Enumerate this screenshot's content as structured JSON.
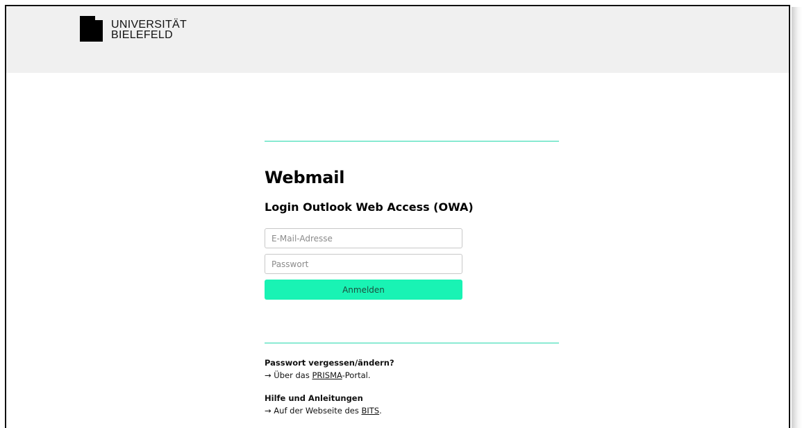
{
  "brand": {
    "line1": "UNIVERSITÄT",
    "line2": "BIELEFELD"
  },
  "main": {
    "title": "Webmail",
    "subtitle": "Login Outlook Web Access (OWA)"
  },
  "form": {
    "email_placeholder": "E-Mail-Adresse",
    "password_placeholder": "Passwort",
    "submit_label": "Anmelden"
  },
  "help": {
    "password_title": "Passwort vergessen/ändern?",
    "password_prefix": "→ Über das ",
    "password_link": "PRISMA",
    "password_suffix": "-Portal.",
    "help_title": "Hilfe und Anleitungen",
    "help_prefix": "→ Auf der Webseite des ",
    "help_link": "BITS",
    "help_suffix": "."
  },
  "colors": {
    "accent": "#19f3b4",
    "rule": "#25d9ac",
    "header_bg": "#f0f0f0"
  }
}
